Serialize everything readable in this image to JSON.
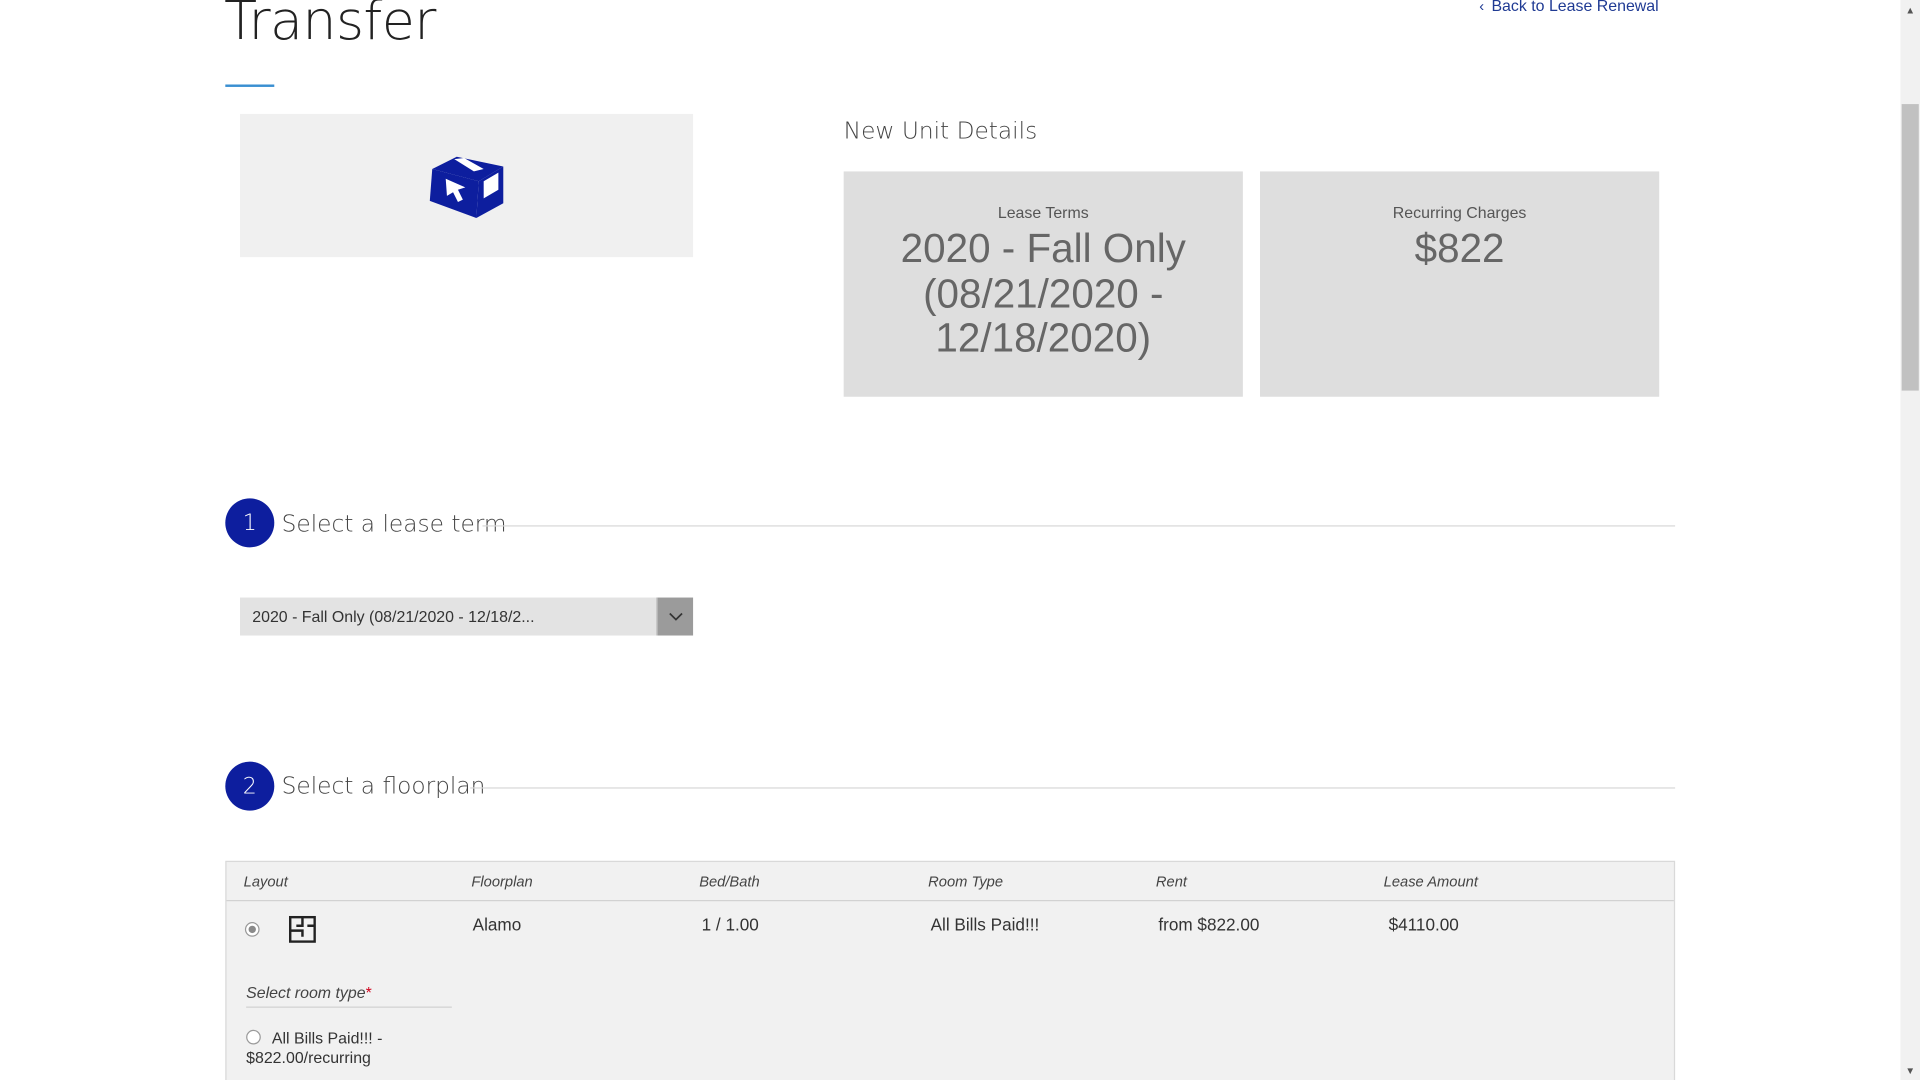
{
  "header": {
    "title": "Transfer",
    "back_link": "Back to Lease Renewal"
  },
  "unit_image": {
    "icon": "package-cursor-icon",
    "accent": "#0d1e9e"
  },
  "new_unit_details": {
    "heading": "New Unit Details",
    "cards": [
      {
        "label": "Lease Terms",
        "value": "2020 - Fall Only (08/21/2020 - 12/18/2020)"
      },
      {
        "label": "Recurring Charges",
        "value": "$822"
      }
    ]
  },
  "steps": [
    {
      "number": "1",
      "title": "Select a lease term"
    },
    {
      "number": "2",
      "title": "Select a floorplan"
    }
  ],
  "lease_term_select": {
    "value": "2020 - Fall Only (08/21/2020 - 12/18/2..."
  },
  "floorplan_table": {
    "columns": [
      "Layout",
      "Floorplan",
      "Bed/Bath",
      "Room Type",
      "Rent",
      "Lease Amount"
    ],
    "rows": [
      {
        "floorplan": "Alamo",
        "bed_bath": "1 / 1.00",
        "room_type": "All Bills Paid!!!",
        "rent": "from $822.00",
        "lease_amount": "$4110.00",
        "selected": true
      }
    ],
    "room_type_label": "Select room type",
    "required_mark": "*",
    "room_options": [
      "All Bills Paid!!! - $822.00/recurring"
    ]
  },
  "colors": {
    "brand": "#0d1e9e",
    "accent_line": "#3a8fd1",
    "link": "#1f3a93"
  }
}
